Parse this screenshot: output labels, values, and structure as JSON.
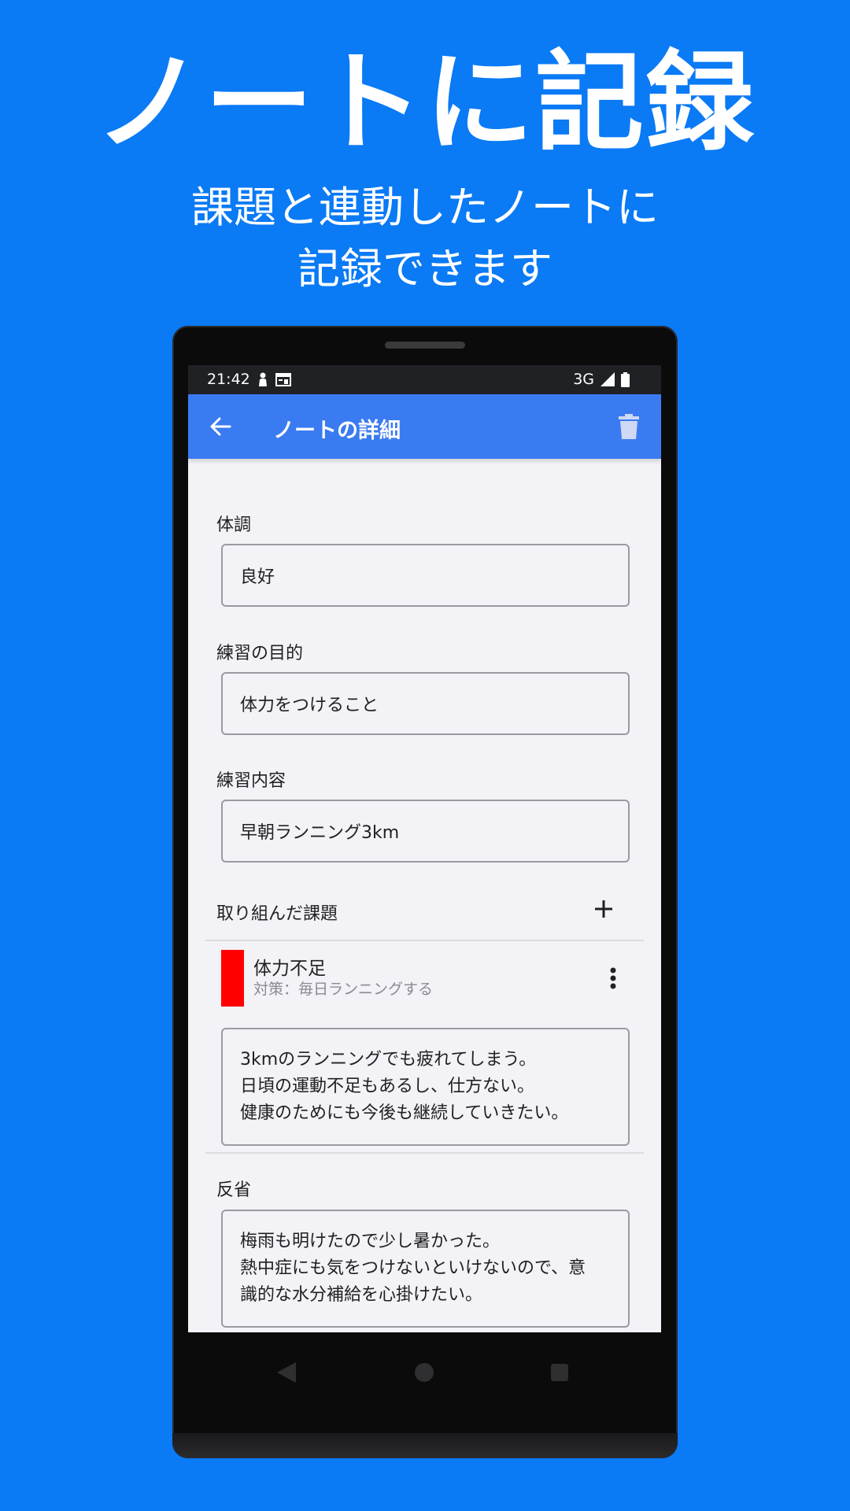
{
  "promo": {
    "headline": "ノートに記録",
    "subline_1": "課題と連動したノートに",
    "subline_2": "記録できます"
  },
  "status_bar": {
    "time": "21:42",
    "network": "3G",
    "icons": [
      "person-icon",
      "calendar-icon",
      "signal-icon",
      "battery-icon"
    ]
  },
  "app_bar": {
    "title": "ノートの詳細",
    "back_icon": "arrow-back-icon",
    "delete_icon": "trash-icon",
    "color": "#3a7bf1"
  },
  "fields": {
    "condition": {
      "label": "体調",
      "value": "良好"
    },
    "purpose": {
      "label": "練習の目的",
      "value": "体力をつけること"
    },
    "detail": {
      "label": "練習内容",
      "value": "早朝ランニング3km"
    }
  },
  "tasks_section": {
    "label": "取り組んだ課題",
    "add_icon": "plus-icon",
    "items": [
      {
        "title": "体力不足",
        "subtitle": "対策：毎日ランニングする",
        "color": "#ff0000",
        "menu_icon": "more-vert-icon",
        "note_lines": [
          "3kmのランニングでも疲れてしまう。",
          "日頃の運動不足もあるし、仕方ない。",
          "健康のためにも今後も継続していきたい。"
        ]
      }
    ]
  },
  "reflection": {
    "label": "反省",
    "lines": [
      "梅雨も明けたので少し暑かった。",
      "熱中症にも気をつけないといけないので、意",
      "識的な水分補給を心掛けたい。"
    ]
  },
  "brand_color": "#0A7AF5"
}
